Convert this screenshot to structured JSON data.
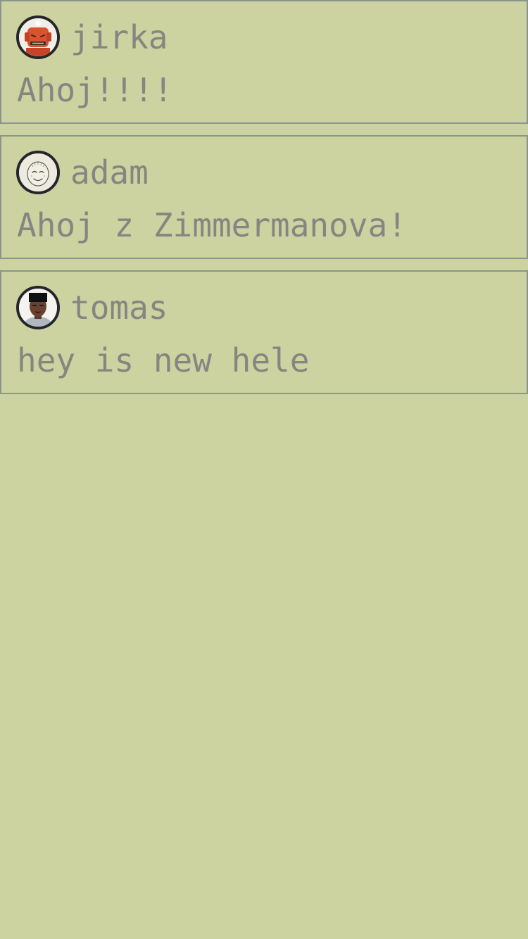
{
  "app": {
    "background_color": "#cdd2a1",
    "text_color": "#858680",
    "border_color": "#8b958d",
    "avatar_ring_color": "#25252c"
  },
  "messages": [
    {
      "username": "jirka",
      "text": "Ahoj!!!!",
      "avatar_icon": "red-robot-avatar-icon"
    },
    {
      "username": "adam",
      "text": "Ahoj z Zimmermanova!",
      "avatar_icon": "smiling-face-avatar-icon"
    },
    {
      "username": "tomas",
      "text": "hey is new hele",
      "avatar_icon": "person-avatar-icon"
    }
  ]
}
